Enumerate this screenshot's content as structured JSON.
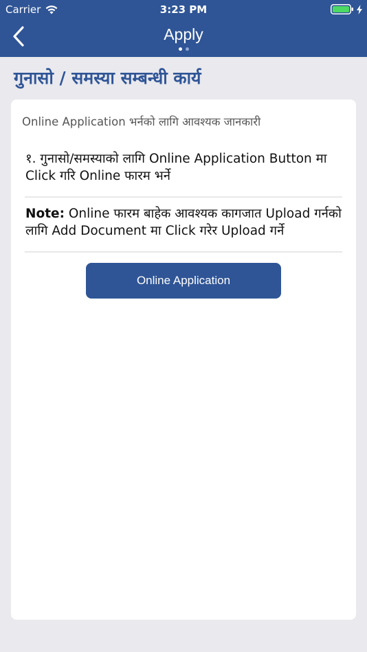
{
  "status_bar": {
    "carrier": "Carrier",
    "time": "3:23 PM",
    "icons": [
      "wifi-icon",
      "battery-icon",
      "charging-icon"
    ]
  },
  "nav": {
    "title": "Apply",
    "back_icon": "chevron-left-icon",
    "page_count": 2,
    "current_page": 1
  },
  "section": {
    "title": "गुनासो / समस्या सम्बन्धी कार्य"
  },
  "card": {
    "intro": "Online Application भर्नको लागि आवश्यक जानकारी",
    "step_1": "१. गुनासो/समस्याको लागि Online Application Button मा Click गरि Online फारम भर्ने",
    "note_label": "Note:",
    "note_body": " Online फारम बाहेक आवश्यक कागजात Upload गर्नको लागि Add Document मा Click गरेर Upload गर्ने",
    "button_label": "Online Application"
  },
  "colors": {
    "primary": "#2f5596",
    "background": "#e9e9ee",
    "card": "#ffffff"
  }
}
